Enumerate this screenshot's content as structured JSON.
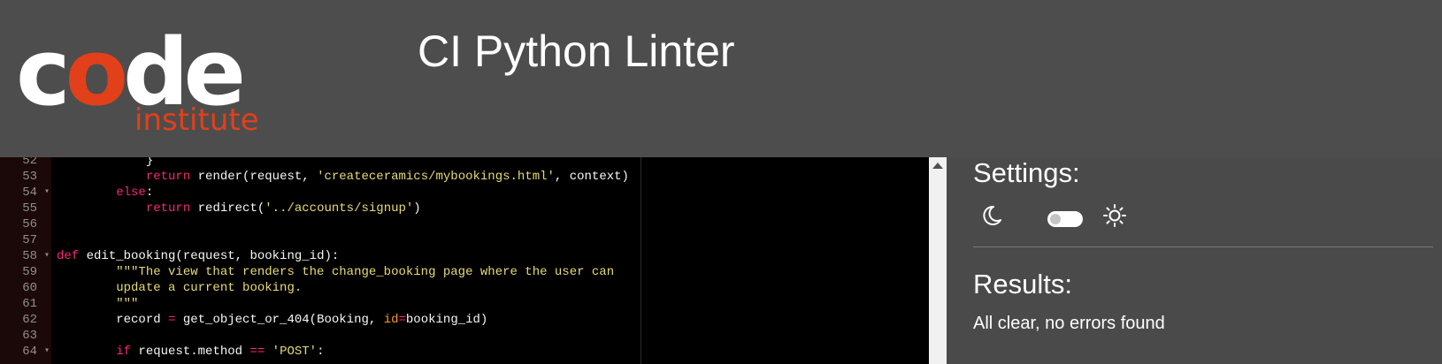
{
  "header": {
    "logo": {
      "word": "code",
      "sub": "institute"
    },
    "title": "CI Python Linter"
  },
  "editor": {
    "lines": [
      {
        "num": "52",
        "fold": false,
        "segments": [
          {
            "t": "            }",
            "c": ""
          }
        ]
      },
      {
        "num": "53",
        "fold": false,
        "segments": [
          {
            "t": "            ",
            "c": ""
          },
          {
            "t": "return",
            "c": "kw"
          },
          {
            "t": " render(request, ",
            "c": ""
          },
          {
            "t": "'createceramics/mybookings.html'",
            "c": "str"
          },
          {
            "t": ", context)",
            "c": ""
          }
        ]
      },
      {
        "num": "54",
        "fold": true,
        "segments": [
          {
            "t": "        ",
            "c": ""
          },
          {
            "t": "else",
            "c": "kw"
          },
          {
            "t": ":",
            "c": ""
          }
        ]
      },
      {
        "num": "55",
        "fold": false,
        "segments": [
          {
            "t": "            ",
            "c": ""
          },
          {
            "t": "return",
            "c": "kw"
          },
          {
            "t": " redirect(",
            "c": ""
          },
          {
            "t": "'../accounts/signup'",
            "c": "str"
          },
          {
            "t": ")",
            "c": ""
          }
        ]
      },
      {
        "num": "56",
        "fold": false,
        "segments": [
          {
            "t": "",
            "c": ""
          }
        ]
      },
      {
        "num": "57",
        "fold": false,
        "segments": [
          {
            "t": "",
            "c": ""
          }
        ]
      },
      {
        "num": "58",
        "fold": true,
        "segments": [
          {
            "t": "def",
            "c": "def"
          },
          {
            "t": " edit_booking(request, booking_id):",
            "c": ""
          }
        ]
      },
      {
        "num": "59",
        "fold": false,
        "segments": [
          {
            "t": "        ",
            "c": ""
          },
          {
            "t": "\"\"\"The view that renders the change_booking page where the user can",
            "c": "str"
          }
        ]
      },
      {
        "num": "60",
        "fold": false,
        "segments": [
          {
            "t": "        ",
            "c": ""
          },
          {
            "t": "update a current booking.",
            "c": "str"
          }
        ]
      },
      {
        "num": "61",
        "fold": false,
        "segments": [
          {
            "t": "        ",
            "c": ""
          },
          {
            "t": "\"\"\"",
            "c": "str"
          }
        ]
      },
      {
        "num": "62",
        "fold": false,
        "segments": [
          {
            "t": "        record ",
            "c": ""
          },
          {
            "t": "=",
            "c": "kw"
          },
          {
            "t": " get_object_or_404(Booking, ",
            "c": ""
          },
          {
            "t": "id",
            "c": "arg"
          },
          {
            "t": "=",
            "c": "kw"
          },
          {
            "t": "booking_id)",
            "c": ""
          }
        ]
      },
      {
        "num": "63",
        "fold": false,
        "segments": [
          {
            "t": "",
            "c": ""
          }
        ]
      },
      {
        "num": "64",
        "fold": true,
        "segments": [
          {
            "t": "        ",
            "c": ""
          },
          {
            "t": "if",
            "c": "kw"
          },
          {
            "t": " request.method ",
            "c": ""
          },
          {
            "t": "==",
            "c": "kw"
          },
          {
            "t": " ",
            "c": ""
          },
          {
            "t": "'POST'",
            "c": "str"
          },
          {
            "t": ":",
            "c": ""
          }
        ]
      }
    ]
  },
  "settings": {
    "heading": "Settings:",
    "dark_icon": "moon-icon",
    "light_icon": "sun-icon",
    "toggle_state": "off"
  },
  "results": {
    "heading": "Results:",
    "message": "All clear, no errors found"
  },
  "colors": {
    "brand": "#e1401a",
    "header_bg": "#4d4d4d",
    "panel_bg": "#4a4a4a",
    "editor_bg": "#000000",
    "keyword": "#f92672",
    "string": "#e6db74"
  }
}
